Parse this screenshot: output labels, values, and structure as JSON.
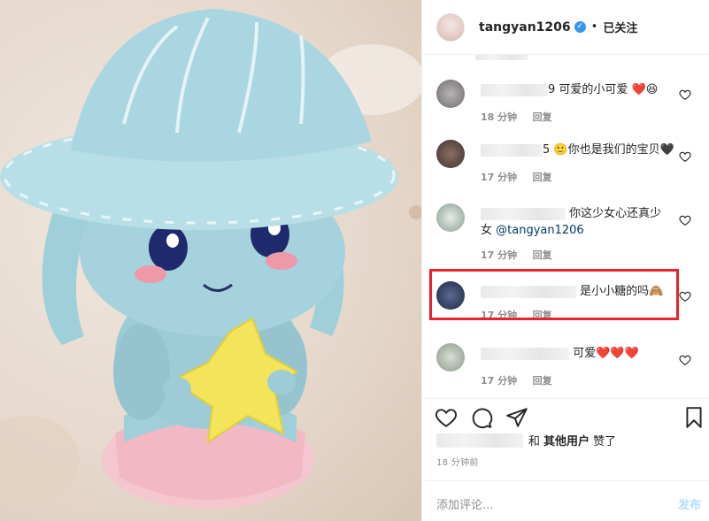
{
  "header": {
    "username": "tangyan1206",
    "dot": "•",
    "follow_label": "已关注"
  },
  "comments": [
    {
      "text_suffix": "9 可爱的小可爱",
      "emoji": "❤️😆",
      "time": "18 分钟",
      "reply": "回复"
    },
    {
      "text_suffix": "5 🙂你也是我们的宝贝🖤",
      "time": "17 分钟",
      "reply": "回复"
    },
    {
      "text_suffix": "你这少女心还真少",
      "text_line2": "女",
      "mention": "@tangyan1206",
      "time": "17 分钟",
      "reply": "回复"
    },
    {
      "text_suffix": "是小小糖的吗🙈",
      "time": "17 分钟",
      "reply": "回复"
    },
    {
      "text_suffix": "可爱❤️❤️❤️",
      "time": "17 分钟",
      "reply": "回复"
    }
  ],
  "likes": {
    "and": "和",
    "others": "其他用户",
    "liked": "赞了"
  },
  "timestamp": "18 分钟前",
  "add_comment": {
    "placeholder": "添加评论...",
    "post_label": "发布"
  },
  "colors": {
    "highlight_box": "#e8232b",
    "verified": "#3897f0",
    "heart_red": "#ed4956"
  }
}
